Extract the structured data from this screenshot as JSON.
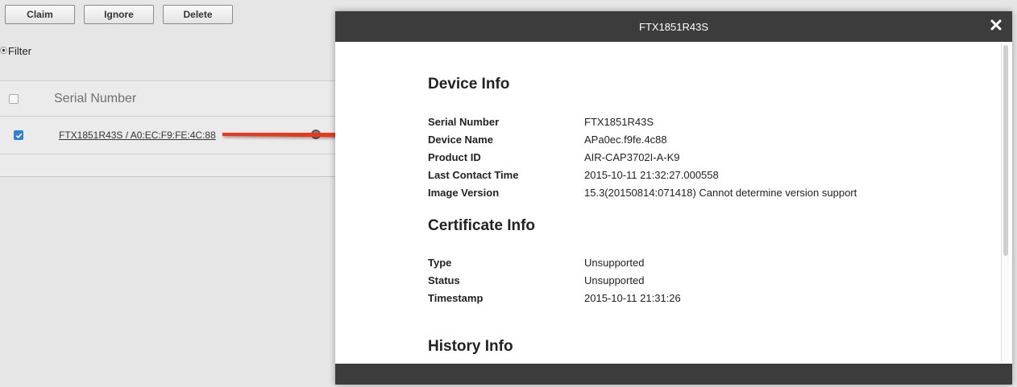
{
  "toolbar": {
    "claim": "Claim",
    "ignore": "Ignore",
    "delete": "Delete"
  },
  "filter": {
    "icon": "⦿",
    "label": "Filter"
  },
  "grid": {
    "header": {
      "serial": "Serial Number"
    },
    "rows": [
      {
        "serial": "FTX1851R43S / A0:EC:F9:FE:4C:88",
        "checked": true
      }
    ]
  },
  "modal": {
    "title": "FTX1851R43S",
    "close_icon": "close-icon",
    "device_info": {
      "title": "Device Info",
      "rows": [
        {
          "label": "Serial Number",
          "value": "FTX1851R43S"
        },
        {
          "label": "Device Name",
          "value": "APa0ec.f9fe.4c88"
        },
        {
          "label": "Product ID",
          "value": "AIR-CAP3702I-A-K9"
        },
        {
          "label": "Last Contact Time",
          "value": "2015-10-11 21:32:27.000558"
        },
        {
          "label": "Image Version",
          "value": "15.3(20150814:071418) Cannot determine version support"
        }
      ]
    },
    "certificate_info": {
      "title": "Certificate Info",
      "rows": [
        {
          "label": "Type",
          "value": "Unsupported"
        },
        {
          "label": "Status",
          "value": "Unsupported"
        },
        {
          "label": "Timestamp",
          "value": "2015-10-11 21:31:26"
        }
      ]
    },
    "history_info": {
      "title": "History Info"
    }
  },
  "colors": {
    "arrow": "#e8371f",
    "modal_bar": "#3c3c3c",
    "checkbox": "#2f7fd9"
  }
}
